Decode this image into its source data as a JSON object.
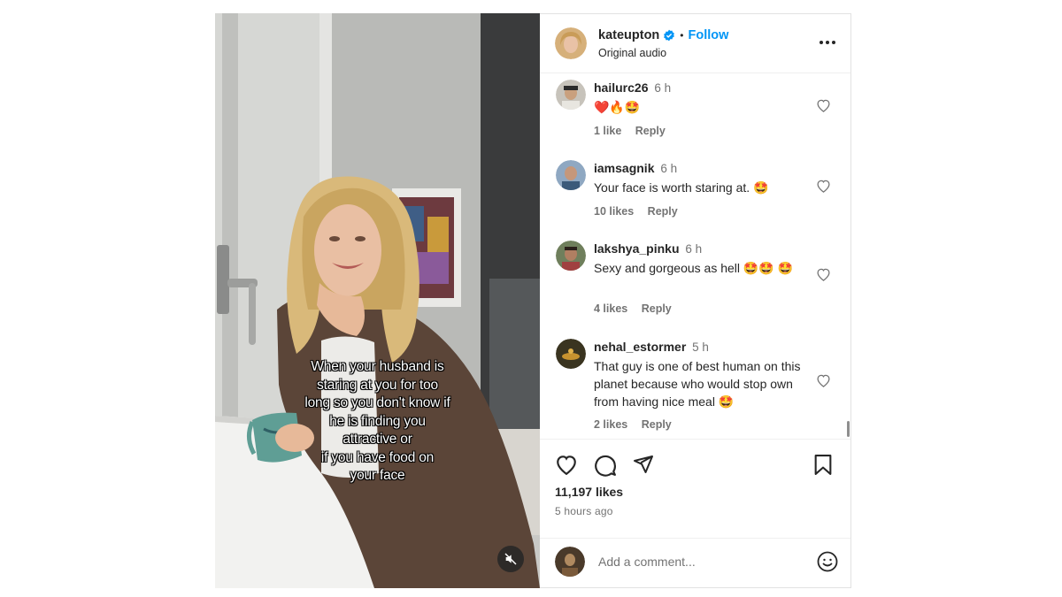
{
  "post": {
    "username": "kateupton",
    "verified": true,
    "follow_label": "Follow",
    "separator": "•",
    "audio_label": "Original audio",
    "caption_lines": [
      "When your husband is",
      "staring at you for too",
      "long so you don't know if",
      "he is finding you",
      "attractive or",
      "if you have food on",
      "your face"
    ],
    "likes": "11,197 likes",
    "timestamp": "5 hours ago"
  },
  "comments": [
    {
      "username": "hailurc26",
      "time": "6 h",
      "text": "❤️🔥🤩",
      "likes": "1 like",
      "reply": "Reply"
    },
    {
      "username": "iamsagnik",
      "time": "6 h",
      "text": "Your face is worth staring at. 🤩",
      "likes": "10 likes",
      "reply": "Reply"
    },
    {
      "username": "lakshya_pinku",
      "time": "6 h",
      "text": "Sexy and gorgeous as hell 🤩🤩 🤩",
      "likes": "4 likes",
      "reply": "Reply"
    },
    {
      "username": "nehal_estormer",
      "time": "5 h",
      "text": "That guy is one of best human on this planet because who would stop own from having nice meal 🤩",
      "likes": "2 likes",
      "reply": "Reply"
    }
  ],
  "add_comment": {
    "placeholder": "Add a comment..."
  },
  "icons": {
    "verified": "verified-badge-icon",
    "more": "more-options-icon",
    "like": "heart-icon",
    "comment": "comment-icon",
    "share": "share-icon",
    "save": "bookmark-icon",
    "emoji": "emoji-icon",
    "mute": "muted-speaker-icon"
  },
  "colors": {
    "accent": "#0095f6",
    "text": "#262626",
    "muted": "#737373"
  }
}
